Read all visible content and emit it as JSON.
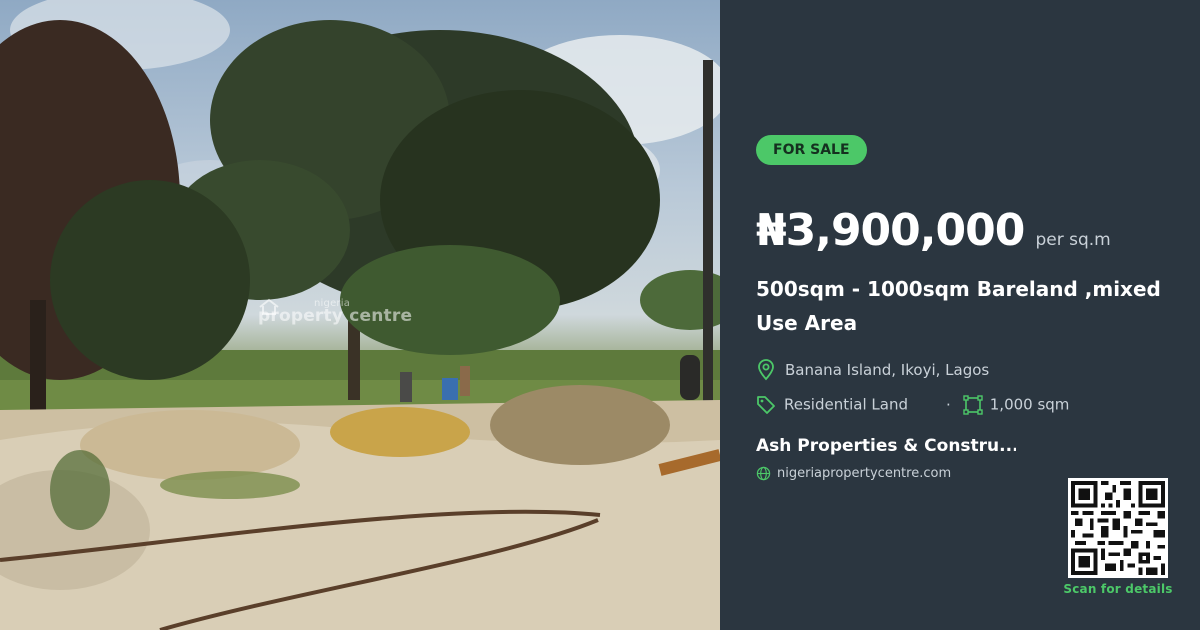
{
  "photo": {
    "watermark_small": "nigeria",
    "watermark_text": "property centre"
  },
  "listing": {
    "badge": "FOR SALE",
    "price": "₦3,900,000",
    "price_unit": "per sq.m",
    "title": "500sqm - 1000sqm Bareland ,mixed Use Area",
    "location": "Banana Island, Ikoyi, Lagos",
    "property_type": "Residential Land",
    "separator": "·",
    "size": "1,000 sqm",
    "agent": "Ash Properties & Constru...",
    "website": "nigeriapropertycentre.com",
    "qr_caption": "Scan for details"
  },
  "icons": {
    "location": "map-pin-icon",
    "type": "tag-icon",
    "size": "area-icon",
    "website": "globe-icon",
    "qr": "qr-code-icon"
  },
  "colors": {
    "panel_bg": "#2b3640",
    "accent_green": "#4cc868",
    "text_primary": "#ffffff",
    "text_secondary": "#c9d1d8"
  }
}
